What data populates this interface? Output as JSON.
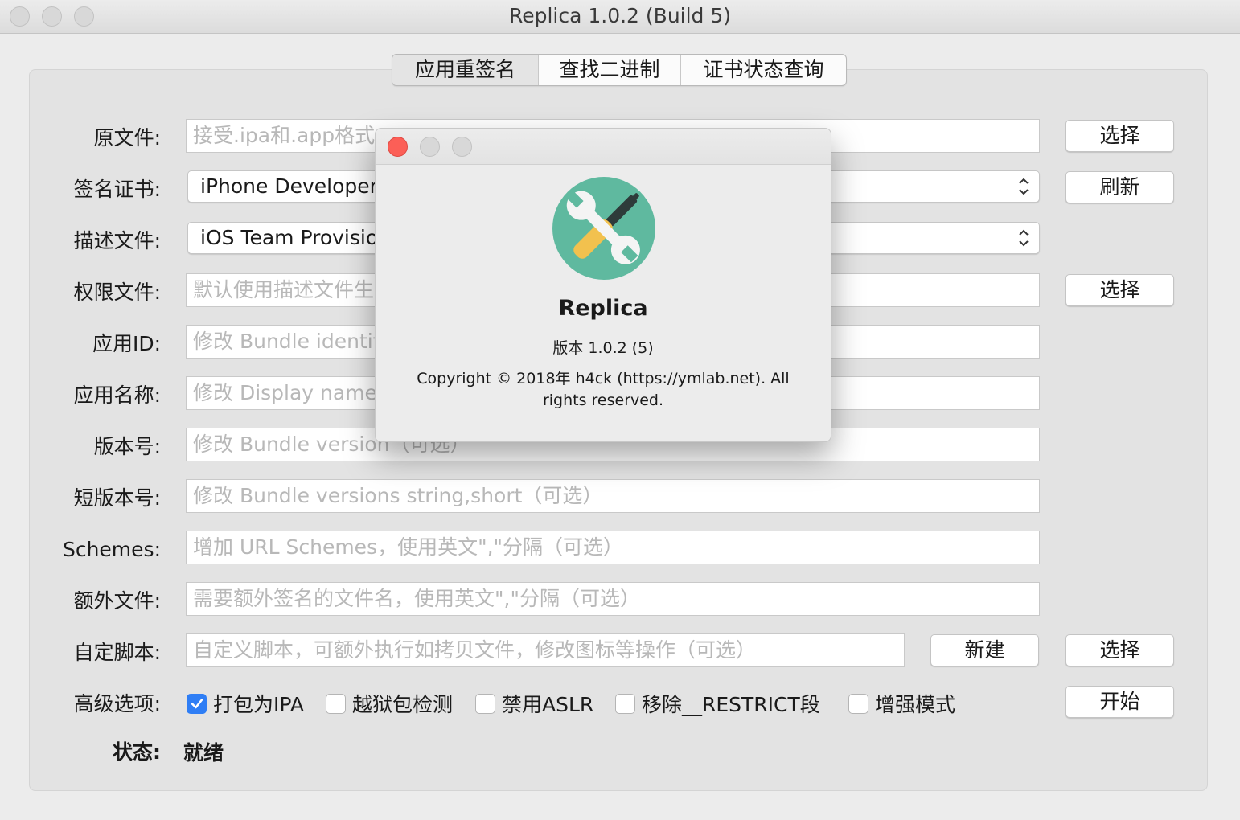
{
  "window": {
    "title": "Replica 1.0.2 (Build 5)"
  },
  "tabs": [
    {
      "label": "应用重签名",
      "active": true
    },
    {
      "label": "查找二进制",
      "active": false
    },
    {
      "label": "证书状态查询",
      "active": false
    }
  ],
  "form": {
    "source_file": {
      "label": "原文件:",
      "placeholder": "接受.ipa和.app格式"
    },
    "certificate": {
      "label": "签名证书:",
      "value": "iPhone Developer:"
    },
    "profile": {
      "label": "描述文件:",
      "value": "iOS Team Provisio"
    },
    "entitlements": {
      "label": "权限文件:",
      "placeholder": "默认使用描述文件生"
    },
    "bundle_id": {
      "label": "应用ID:",
      "placeholder": "修改 Bundle identif"
    },
    "app_name": {
      "label": "应用名称:",
      "placeholder": "修改 Display name"
    },
    "version": {
      "label": "版本号:",
      "placeholder": "修改 Bundle version（可选）"
    },
    "short_version": {
      "label": "短版本号:",
      "placeholder": "修改 Bundle versions string,short（可选）"
    },
    "schemes": {
      "label": "Schemes:",
      "placeholder": "增加 URL Schemes，使用英文\",\"分隔（可选）"
    },
    "extra_files": {
      "label": "额外文件:",
      "placeholder": "需要额外签名的文件名，使用英文\",\"分隔（可选）"
    },
    "custom_script": {
      "label": "自定脚本:",
      "placeholder": "自定义脚本，可额外执行如拷贝文件，修改图标等操作（可选）"
    },
    "advanced": {
      "label": "高级选项:"
    },
    "status": {
      "label": "状态:",
      "value": "就绪"
    }
  },
  "buttons": {
    "choose": "选择",
    "refresh": "刷新",
    "new": "新建",
    "start": "开始"
  },
  "options": [
    {
      "label": "打包为IPA",
      "checked": true
    },
    {
      "label": "越狱包检测",
      "checked": false
    },
    {
      "label": "禁用ASLR",
      "checked": false
    },
    {
      "label": "移除__RESTRICT段",
      "checked": false
    },
    {
      "label": "增强模式",
      "checked": false
    }
  ],
  "about": {
    "app_name": "Replica",
    "version": "版本 1.0.2 (5)",
    "copyright": "Copyright © 2018年 h4ck (https://ymlab.net). All rights reserved.",
    "icon": "tools-icon"
  },
  "colors": {
    "accent": "#2f7ef5",
    "icon_bg": "#5fb99f",
    "close": "#fc5f57"
  }
}
